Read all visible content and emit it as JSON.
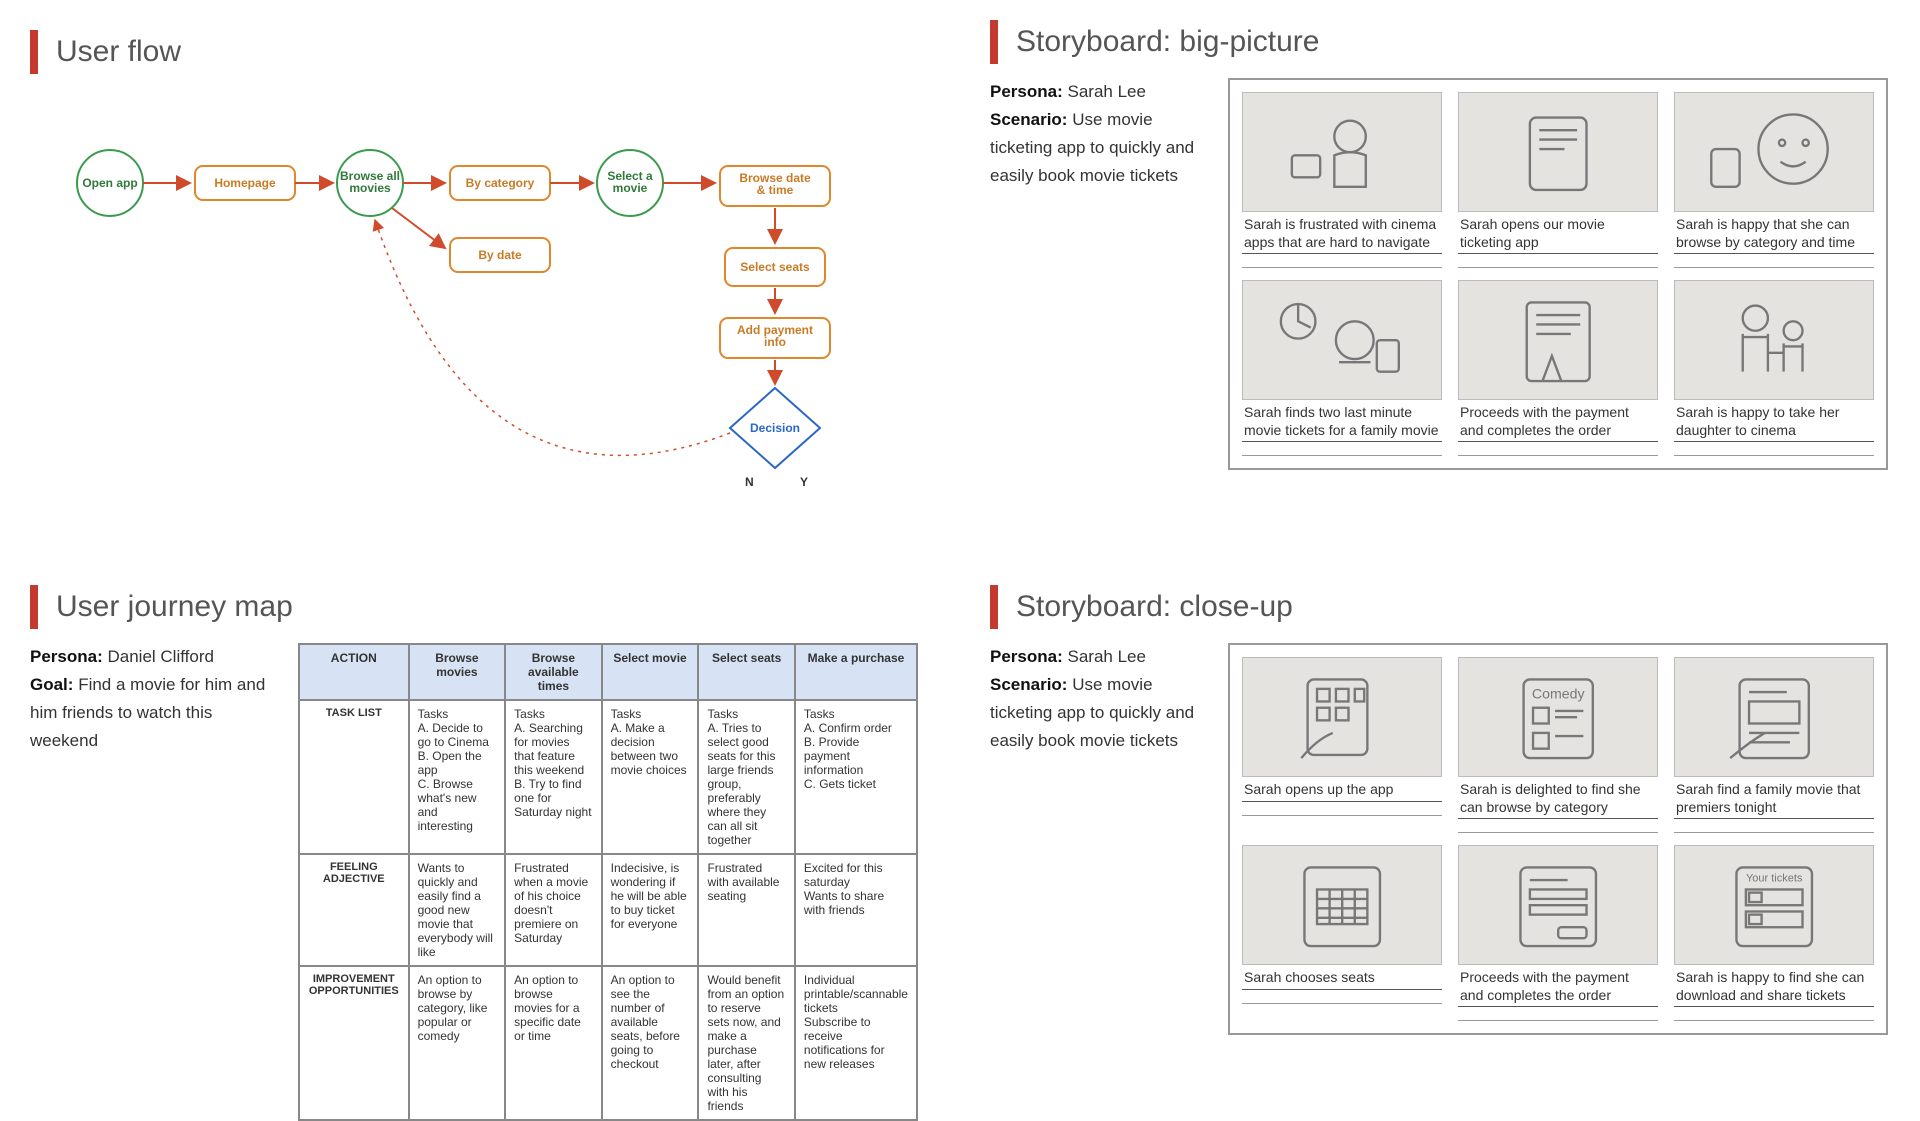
{
  "q1": {
    "title": "User flow",
    "nodes": {
      "open": "Open app",
      "home": "Homepage",
      "browse": "Browse all movies",
      "bycat": "By category",
      "bydate": "By date",
      "select": "Select a movie",
      "datetime": "Browse date & time",
      "seats": "Select seats",
      "pay": "Add payment info",
      "decision": "Decision",
      "n": "N",
      "y": "Y"
    }
  },
  "q2": {
    "title": "Storyboard: big-picture",
    "persona_label": "Persona:",
    "persona": "Sarah Lee",
    "scenario_label": "Scenario:",
    "scenario": "Use movie ticketing app to quickly and easily book movie tickets",
    "captions": [
      "Sarah is frustrated with cinema apps that are hard to navigate",
      "Sarah opens our movie ticketing app",
      "Sarah is happy that she can browse by category and time",
      "Sarah finds two last minute  movie tickets for a family movie",
      "Proceeds with the payment and completes the order",
      "Sarah is happy to take her daughter to cinema"
    ]
  },
  "q3": {
    "title": "User journey map",
    "persona_label": "Persona:",
    "persona": "Daniel Clifford",
    "goal_label": "Goal:",
    "goal": "Find a movie for him and him friends to watch this weekend",
    "table": {
      "headers": [
        "ACTION",
        "Browse movies",
        "Browse available times",
        "Select movie",
        "Select seats",
        "Make a purchase"
      ],
      "rows": [
        {
          "h": "TASK LIST",
          "c": [
            "Tasks\nA. Decide to go to Cinema\nB. Open the app\nC. Browse what's new and interesting",
            "Tasks\nA. Searching for movies that feature this weekend\nB. Try to find one for Saturday night",
            "Tasks\nA. Make a decision between two movie choices",
            "Tasks\nA. Tries to select good seats for this large friends group, preferably where they can all sit together",
            "Tasks\nA. Confirm order\nB. Provide payment information\nC. Gets ticket"
          ]
        },
        {
          "h": "FEELING ADJECTIVE",
          "c": [
            "Wants to quickly and easily find a good new movie that everybody will like",
            "Frustrated when a movie of his choice doesn't premiere on Saturday",
            "Indecisive, is wondering if he will be able to buy ticket for everyone",
            "Frustrated with available seating",
            "Excited for this saturday\nWants to share with friends"
          ]
        },
        {
          "h": "IMPROVEMENT OPPORTUNITIES",
          "c": [
            "An option to browse by category, like popular or comedy",
            "An option to browse movies for a specific date or time",
            "An option to see the number of available seats, before going to checkout",
            "Would benefit from an option to reserve sets now, and make a purchase later, after consulting with his friends",
            "Individual printable/scannable tickets\nSubscribe to receive notifications for new releases"
          ]
        }
      ]
    }
  },
  "q4": {
    "title": "Storyboard: close-up",
    "persona_label": "Persona:",
    "persona": "Sarah Lee",
    "scenario_label": "Scenario:",
    "scenario": "Use movie ticketing app to quickly and easily book movie tickets",
    "captions": [
      "Sarah opens up the app",
      "Sarah is delighted to find she can browse by category",
      "Sarah find a family movie that premiers tonight",
      "Sarah chooses seats",
      "Proceeds with the payment and completes the order",
      "Sarah is happy to find she can download and share tickets"
    ]
  }
}
